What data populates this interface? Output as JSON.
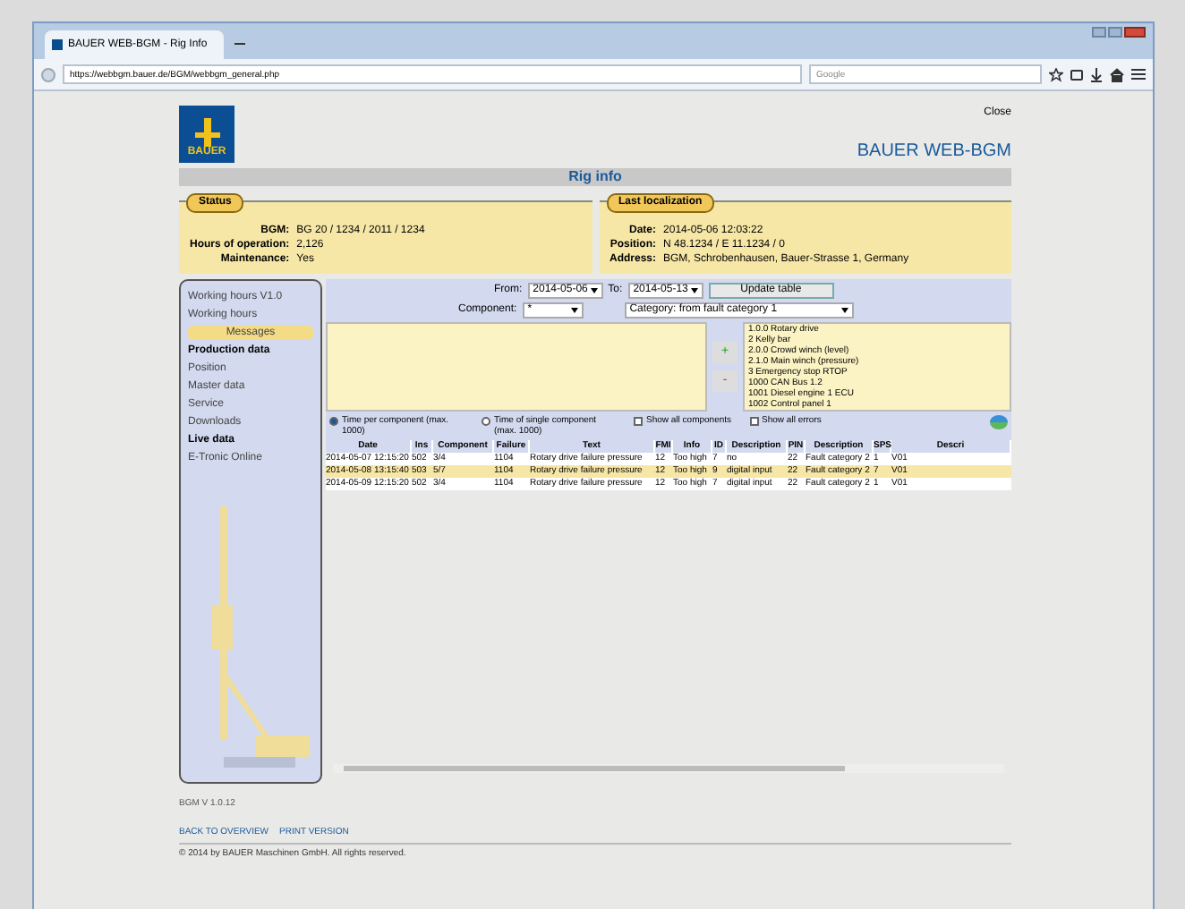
{
  "browser": {
    "tab_title": "BAUER WEB-BGM - Rig Info",
    "url": "https://webbgm.bauer.de/BGM/webbgm_general.php",
    "search_placeholder": "Google"
  },
  "header": {
    "close": "Close",
    "logo": "BAUER",
    "app_title": "BAUER WEB-BGM",
    "page_title": "Rig info"
  },
  "status": {
    "label": "Status",
    "rows": [
      {
        "key": "BGM:",
        "value": "BG 20 / 1234 / 2011 / 1234"
      },
      {
        "key": "Hours of operation:",
        "value": "2,126"
      },
      {
        "key": "Maintenance:",
        "value": "Yes"
      }
    ]
  },
  "localization": {
    "label": "Last localization",
    "rows": [
      {
        "key": "Date:",
        "value": "2014-05-06 12:03:22"
      },
      {
        "key": "Position:",
        "value": "N 48.1234 / E 11.1234 / 0"
      },
      {
        "key": "Address:",
        "value": "BGM, Schrobenhausen, Bauer-Strasse 1, Germany"
      }
    ]
  },
  "sidebar": {
    "items": [
      {
        "label": "Working hours V1.0",
        "selected": false,
        "bold": false
      },
      {
        "label": "Working hours",
        "selected": false,
        "bold": false
      },
      {
        "label": "Messages",
        "selected": true,
        "bold": false
      },
      {
        "label": "Production data",
        "selected": false,
        "bold": true
      },
      {
        "label": "Position",
        "selected": false,
        "bold": false
      },
      {
        "label": "Master data",
        "selected": false,
        "bold": false
      },
      {
        "label": "Service",
        "selected": false,
        "bold": false
      },
      {
        "label": "Downloads",
        "selected": false,
        "bold": false
      },
      {
        "label": "Live data",
        "selected": false,
        "bold": true
      },
      {
        "label": "E-Tronic Online",
        "selected": false,
        "bold": false
      }
    ]
  },
  "filters": {
    "from_label": "From:",
    "from_value": "2014-05-06",
    "to_label": "To:",
    "to_value": "2014-05-13",
    "update_button": "Update table",
    "component_label": "Component:",
    "component_value": "*",
    "category_value": "Category: from fault category 1"
  },
  "add_button": "+",
  "remove_button": "-",
  "categories": [
    "1.0.0 Rotary drive",
    "2 Kelly bar",
    "2.0.0 Crowd winch (level)",
    "2.1.0 Main winch (pressure)",
    "3 Emergency stop RTOP",
    "1000 CAN Bus 1.2",
    "1001 Diesel engine 1 ECU",
    "1002 Control panel 1"
  ],
  "options": [
    {
      "kind": "radio",
      "label": "Time per component (max. 1000)",
      "checked": true
    },
    {
      "kind": "radio",
      "label": "Time of single component (max. 1000)",
      "checked": false
    },
    {
      "kind": "checkbox",
      "label": "Show all components",
      "checked": false
    },
    {
      "kind": "checkbox",
      "label": "Show all errors",
      "checked": false
    }
  ],
  "table": {
    "columns": [
      "Date",
      "Ins",
      "Component",
      "Failure",
      "Text",
      "FMI",
      "Info",
      "ID",
      "Description",
      "PIN",
      "Description",
      "SPS",
      "Descri"
    ],
    "rows": [
      {
        "selected": false,
        "cells": [
          "2014-05-07 12:15:20",
          "502",
          "3/4",
          "1104",
          "Rotary drive failure pressure",
          "12",
          "Too high",
          "7",
          "no",
          "22",
          "Fault category 2",
          "1",
          "V01"
        ]
      },
      {
        "selected": true,
        "cells": [
          "2014-05-08 13:15:40",
          "503",
          "5/7",
          "1104",
          "Rotary drive failure pressure",
          "12",
          "Too high",
          "9",
          "digital input",
          "22",
          "Fault category 2",
          "7",
          "V01"
        ]
      },
      {
        "selected": false,
        "cells": [
          "2014-05-09 12:15:20",
          "502",
          "3/4",
          "1104",
          "Rotary drive failure pressure",
          "12",
          "Too high",
          "7",
          "digital input",
          "22",
          "Fault category 2",
          "1",
          "V01"
        ]
      }
    ]
  },
  "version": "BGM V 1.0.12",
  "links": [
    "BACK TO OVERVIEW",
    "PRINT VERSION"
  ],
  "footer": "© 2014 by BAUER Maschinen GmbH. All rights reserved."
}
